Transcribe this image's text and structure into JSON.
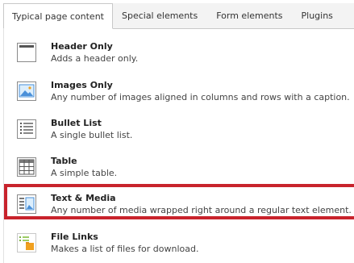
{
  "tabs": [
    {
      "label": "Typical page content",
      "active": true
    },
    {
      "label": "Special elements",
      "active": false
    },
    {
      "label": "Form elements",
      "active": false
    },
    {
      "label": "Plugins",
      "active": false
    }
  ],
  "items": [
    {
      "title": "Header Only",
      "description": "Adds a header only.",
      "icon": "header-only-icon"
    },
    {
      "title": "Images Only",
      "description": "Any number of images aligned in columns and rows with a caption.",
      "icon": "images-only-icon"
    },
    {
      "title": "Bullet List",
      "description": "A single bullet list.",
      "icon": "bullet-list-icon"
    },
    {
      "title": "Table",
      "description": "A simple table.",
      "icon": "table-icon"
    },
    {
      "title": "Text & Media",
      "description": "Any number of media wrapped right around a regular text element.",
      "icon": "text-media-icon",
      "highlighted": true
    },
    {
      "title": "File Links",
      "description": "Makes a list of files for download.",
      "icon": "file-links-icon"
    }
  ],
  "colors": {
    "highlight_border": "#c8232c",
    "icon_blue": "#4a90d9",
    "icon_orange": "#f0a020",
    "icon_green": "#7cb342"
  }
}
